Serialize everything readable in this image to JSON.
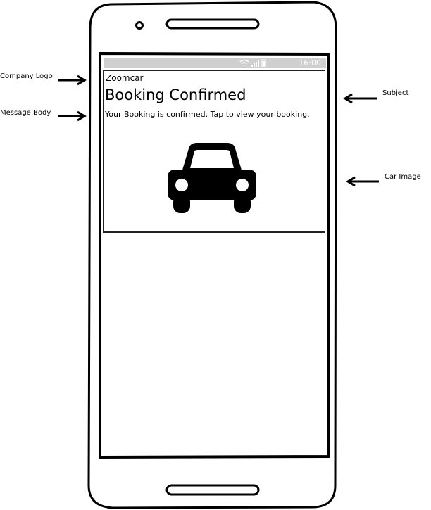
{
  "annotations": {
    "company_logo": "Company Logo",
    "message_body": "Message Body",
    "subject": "Subject",
    "car_image": "Car Image"
  },
  "status_bar": {
    "time": "16:00",
    "icons": [
      "wifi-icon",
      "signal-icon",
      "battery-icon"
    ]
  },
  "notification": {
    "company": "Zoomcar",
    "subject": "Booking Confirmed",
    "body": "Your Booking is confirmed. Tap to view your booking.",
    "image_icon": "car-icon"
  },
  "colors": {
    "status_bar": "#cfcfcf",
    "outline": "#000000"
  }
}
